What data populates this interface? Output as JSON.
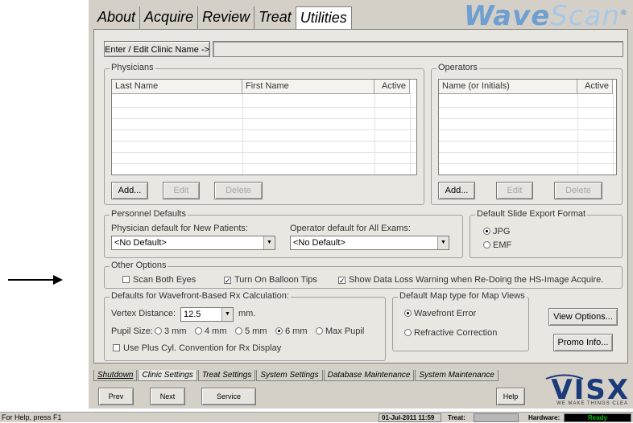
{
  "arrow_icon": "right-arrow",
  "top_tabs": [
    "About",
    "Acquire",
    "Review",
    "Treat",
    "Utilities"
  ],
  "active_top_tab": "Utilities",
  "logo": {
    "part1": "Wave",
    "part2": "Scan",
    "mark": "®"
  },
  "clinic": {
    "button": "Enter / Edit Clinic Name ->",
    "value": ""
  },
  "physicians": {
    "label": "Physicians",
    "columns": [
      "Last Name",
      "First Name",
      "Active"
    ],
    "buttons": {
      "add": "Add...",
      "edit": "Edit",
      "delete": "Delete"
    }
  },
  "operators": {
    "label": "Operators",
    "columns": [
      "Name (or Initials)",
      "Active"
    ],
    "buttons": {
      "add": "Add...",
      "edit": "Edit",
      "delete": "Delete"
    }
  },
  "personnel": {
    "label": "Personnel Defaults",
    "physician_label": "Physician default for New Patients:",
    "physician_value": "<No Default>",
    "operator_label": "Operator default for All Exams:",
    "operator_value": "<No Default>"
  },
  "slide_export": {
    "label": "Default Slide Export Format",
    "options": [
      "JPG",
      "EMF"
    ],
    "selected": "JPG"
  },
  "other_options": {
    "label": "Other Options",
    "scan_both_eyes": {
      "label": "Scan Both Eyes",
      "checked": false
    },
    "balloon_tips": {
      "label": "Turn On Balloon Tips",
      "checked": true
    },
    "data_loss": {
      "label": "Show Data Loss Warning when Re-Doing the HS-Image Acquire.",
      "checked": true
    }
  },
  "rx": {
    "label": "Defaults for Wavefront-Based Rx Calculation:",
    "vertex_label": "Vertex Distance:",
    "vertex_value": "12.5",
    "vertex_unit": "mm.",
    "pupil_label": "Pupil Size:",
    "pupil_options": [
      "3 mm",
      "4 mm",
      "5 mm",
      "6 mm",
      "Max Pupil"
    ],
    "pupil_selected": "6 mm",
    "plus_cyl": {
      "label": "Use Plus Cyl.  Convention for Rx Display",
      "checked": false
    }
  },
  "map_type": {
    "label": "Default Map type for Map Views",
    "options": [
      "Wavefront Error",
      "Refractive Correction"
    ],
    "selected": "Wavefront Error"
  },
  "side_buttons": {
    "view_options": "View Options...",
    "promo": "Promo Info..."
  },
  "bottom_tabs": [
    "Shutdown",
    "Clinic Settings",
    "Treat Settings",
    "System Settings",
    "Database Maintenance",
    "System Maintenance"
  ],
  "active_bottom_tab": "Clinic Settings",
  "nav_buttons": {
    "prev": "Prev",
    "next": "Next",
    "service": "Service",
    "help": "Help"
  },
  "brand": {
    "name": "VISX",
    "tagline": "WE MAKE THINGS CLEA"
  },
  "status": {
    "help": "For Help, press F1",
    "datetime": "01-Jul-2011 11:59",
    "treat_label": "Treat:",
    "hardware_label": "Hardware:",
    "hardware_status": "Ready"
  },
  "colors": {
    "ready": "#00b000",
    "logo": "#6f9fd0",
    "brand": "#1a3a7a"
  }
}
